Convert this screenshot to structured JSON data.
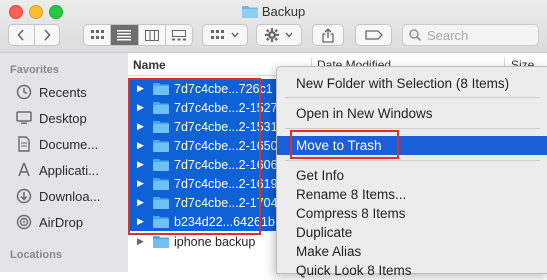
{
  "window": {
    "title": "Backup"
  },
  "toolbar": {
    "search_placeholder": "Search",
    "icons": [
      "chevron-left-icon",
      "chevron-right-icon",
      "icon-view-icon",
      "list-view-icon",
      "column-view-icon",
      "gallery-view-icon",
      "group-icon",
      "gear-icon",
      "share-icon",
      "tag-icon",
      "search-icon"
    ]
  },
  "sidebar": {
    "favorites_header": "Favorites",
    "favorites": [
      {
        "label": "Recents",
        "icon": "clock-icon"
      },
      {
        "label": "Desktop",
        "icon": "desktop-icon"
      },
      {
        "label": "Docume...",
        "icon": "document-icon"
      },
      {
        "label": "Applicati...",
        "icon": "applications-icon"
      },
      {
        "label": "Downloa...",
        "icon": "download-icon"
      },
      {
        "label": "AirDrop",
        "icon": "airdrop-icon"
      }
    ],
    "locations_header": "Locations"
  },
  "list": {
    "columns": {
      "name": "Name",
      "date": "Date Modified",
      "size": "Size"
    },
    "rows": [
      {
        "name": "7d7c4cbe...726c1",
        "selected": true
      },
      {
        "name": "7d7c4cbe...2-1527",
        "selected": true
      },
      {
        "name": "7d7c4cbe...2-1531",
        "selected": true
      },
      {
        "name": "7d7c4cbe...2-1650",
        "selected": true
      },
      {
        "name": "7d7c4cbe...2-1606",
        "selected": true
      },
      {
        "name": "7d7c4cbe...2-1619",
        "selected": true
      },
      {
        "name": "7d7c4cbe...2-1704",
        "selected": true
      },
      {
        "name": "b234d22...64261b",
        "selected": true
      },
      {
        "name": "iphone backup",
        "selected": false
      }
    ]
  },
  "context_menu": {
    "items": [
      "New Folder with Selection (8 Items)",
      "Open in New Windows",
      "Move to Trash",
      "Get Info",
      "Rename 8 Items...",
      "Compress 8 Items",
      "Duplicate",
      "Make Alias",
      "Quick Look 8 Items"
    ],
    "highlighted": "Move to Trash"
  },
  "colors": {
    "selection": "#0f62d6",
    "menu_highlight": "#1a5fd8",
    "annotation": "#d9322b",
    "folder": "#5ab4ef"
  }
}
